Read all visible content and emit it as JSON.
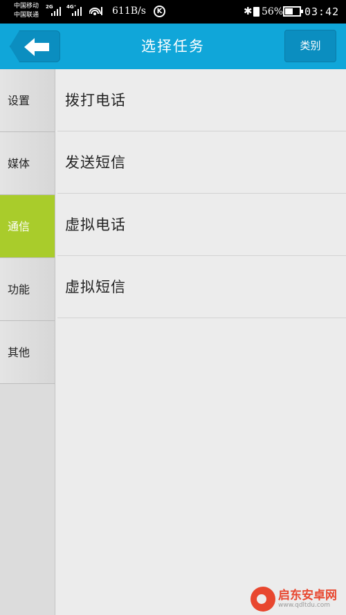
{
  "status_bar": {
    "carrier_1": "中国移动",
    "carrier_2": "中国联通",
    "net_tag_1": "2G",
    "net_tag_2": "4G⁺",
    "speed": "611B/s",
    "k_badge": "K",
    "battery_pct": "56%",
    "battery_level": 0.56,
    "time": "03:42"
  },
  "header": {
    "back_icon": "arrow-left-icon",
    "title": "选择任务",
    "category_label": "类别"
  },
  "sidebar": {
    "items": [
      {
        "label": "设置",
        "active": false
      },
      {
        "label": "媒体",
        "active": false
      },
      {
        "label": "通信",
        "active": true
      },
      {
        "label": "功能",
        "active": false
      },
      {
        "label": "其他",
        "active": false
      }
    ]
  },
  "tasks": [
    {
      "label": "拨打电话"
    },
    {
      "label": "发送短信"
    },
    {
      "label": "虚拟电话"
    },
    {
      "label": "虚拟短信"
    }
  ],
  "watermark": {
    "title": "启东安卓网",
    "url": "www.qdltdu.com"
  },
  "colors": {
    "header": "#10a6d9",
    "active_tab": "#a9cc2b",
    "background": "#ececec"
  }
}
